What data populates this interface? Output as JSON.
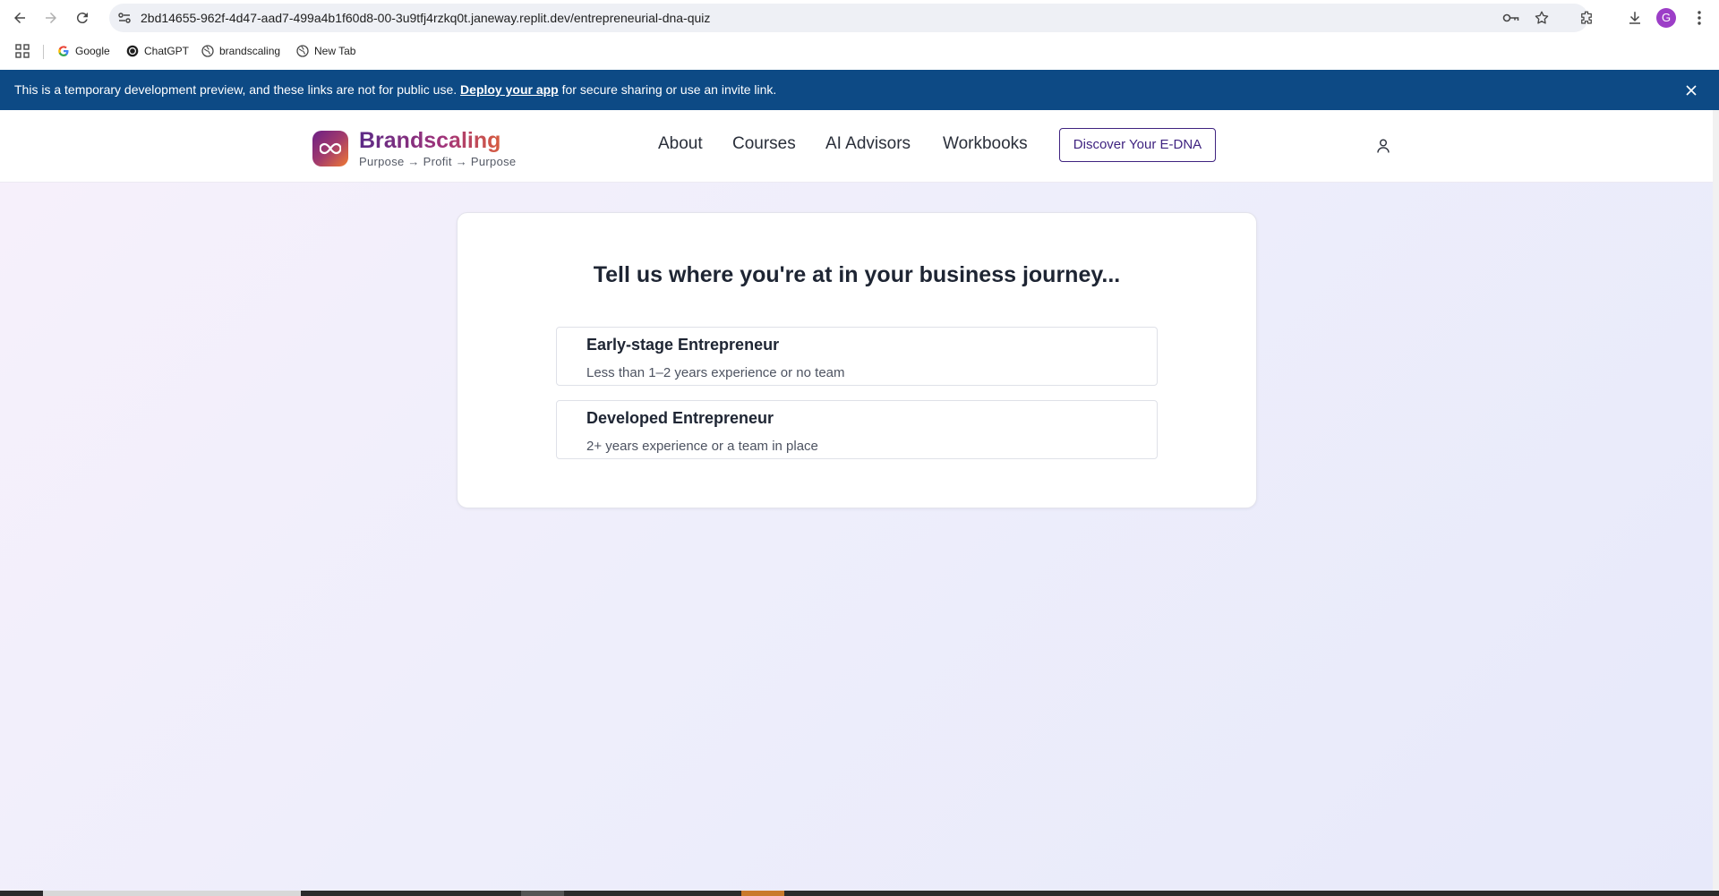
{
  "browser": {
    "url": "2bd14655-962f-4d47-aad7-499a4b1f60d8-00-3u9tfj4rzkq0t.janeway.replit.dev/entrepreneurial-dna-quiz",
    "profile_initial": "G",
    "profile_color": "#9c3ec7"
  },
  "bookmarks": [
    {
      "label": "Google",
      "icon": "google-icon"
    },
    {
      "label": "ChatGPT",
      "icon": "chatgpt-icon"
    },
    {
      "label": "brandscaling",
      "icon": "globe-icon"
    },
    {
      "label": "New Tab",
      "icon": "globe-icon"
    }
  ],
  "dev_banner": {
    "text_before": "This is a temporary development preview, and these links are not for public use.",
    "link": "Deploy your app",
    "text_after": "for secure sharing or use an invite link.",
    "background": "#0d4a85"
  },
  "site": {
    "brand_name": "Brandscaling",
    "tagline": "Purpose → Profit → Purpose",
    "nav": [
      "About",
      "Courses",
      "AI Advisors",
      "Workbooks"
    ],
    "cta": "Discover Your E-DNA",
    "accent": "#3f2380"
  },
  "quiz": {
    "title": "Tell us where you're at in your business journey...",
    "options": [
      {
        "title": "Early-stage Entrepreneur",
        "desc": "Less than 1–2 years experience or no team"
      },
      {
        "title": "Developed Entrepreneur",
        "desc": "2+ years experience or a team in place"
      }
    ]
  }
}
